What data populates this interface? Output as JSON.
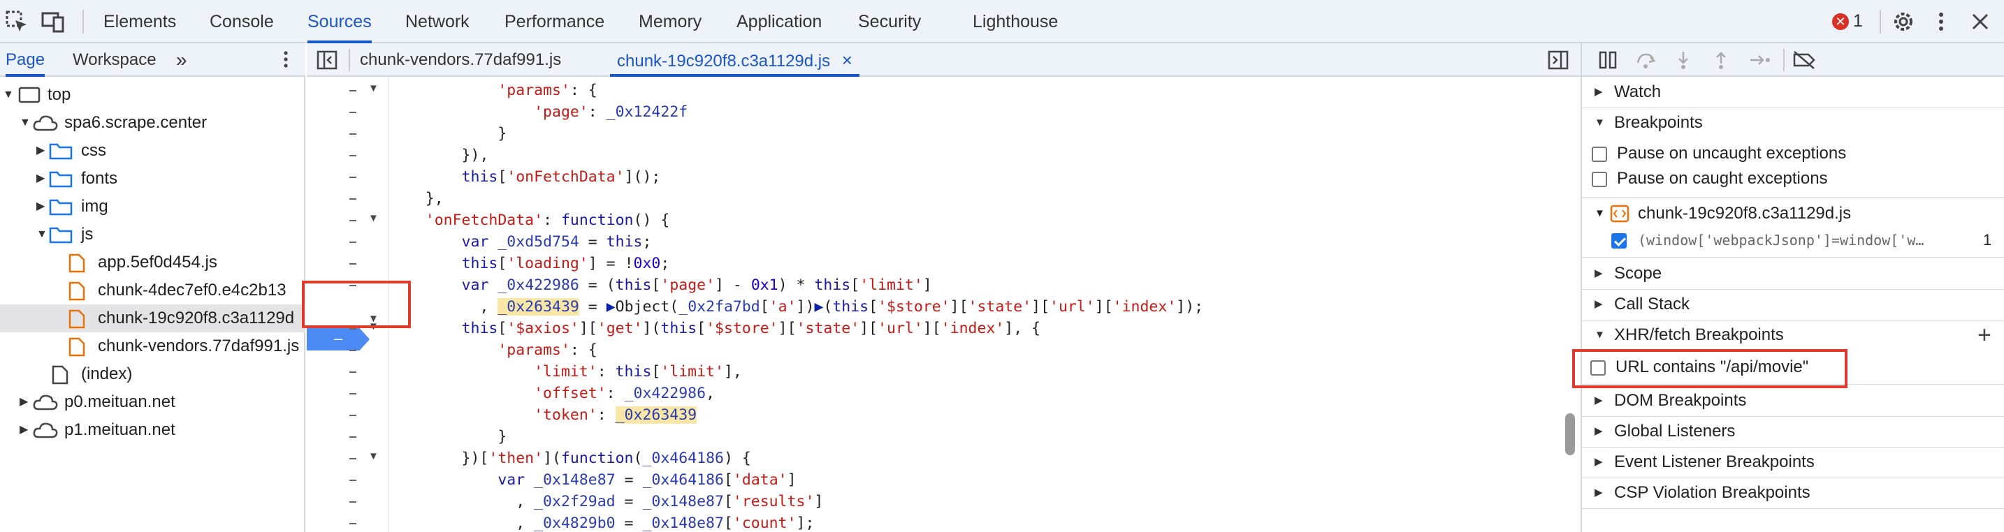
{
  "toolbar": {
    "tabs": [
      "Elements",
      "Console",
      "Sources",
      "Network",
      "Performance",
      "Memory",
      "Application",
      "Security",
      "Lighthouse"
    ],
    "active_tab": "Sources",
    "error_count": "1"
  },
  "navigator": {
    "tabs": [
      "Page",
      "Workspace"
    ],
    "more": "»",
    "tree": [
      {
        "label": "top"
      },
      {
        "label": "spa6.scrape.center"
      },
      {
        "label": "css"
      },
      {
        "label": "fonts"
      },
      {
        "label": "img"
      },
      {
        "label": "js"
      },
      {
        "label": "app.5ef0d454.js"
      },
      {
        "label": "chunk-4dec7ef0.e4c2b13"
      },
      {
        "label": "chunk-19c920f8.c3a1129d"
      },
      {
        "label": "chunk-vendors.77daf991.js"
      },
      {
        "label": "(index)"
      },
      {
        "label": "p0.meituan.net"
      },
      {
        "label": "p1.meituan.net"
      }
    ]
  },
  "editor": {
    "tabs": [
      "chunk-vendors.77daf991.js",
      "chunk-19c920f8.c3a1129d.js"
    ],
    "close_icon": "×",
    "breakpoint_marker": "–",
    "code": [
      "            'params': {",
      "                'page': _0x12422f",
      "            }",
      "        }),",
      "        this['onFetchData']();",
      "    },",
      "    'onFetchData': function() {",
      "        var _0xd5d754 = this;",
      "        this['loading'] = !0x0;",
      "        var _0x422986 = (this['page'] - 0x1) * this['limit']",
      "          , _0x263439 = ▶Object(_0x2fa7bd['a'])▶(this['$store']['state']['url']['index']);",
      "        this['$axios']['get'](this['$store']['state']['url']['index'], {",
      "            'params': {",
      "                'limit': this['limit'],",
      "                'offset': _0x422986,",
      "                'token': _0x263439",
      "            }",
      "        })['then'](function(_0x464186) {",
      "            var _0x148e87 = _0x464186['data']",
      "              , _0x2f29ad = _0x148e87['results']",
      "              , _0x4829b0 = _0x148e87['count'];"
    ]
  },
  "debugger": {
    "sections": {
      "watch": "Watch",
      "breakpoints": "Breakpoints",
      "pause_uncaught": "Pause on uncaught exceptions",
      "pause_caught": "Pause on caught exceptions",
      "bp_file": "chunk-19c920f8.c3a1129d.js",
      "bp_code": "(window['webpackJsonp']=window['w…",
      "bp_line": "1",
      "scope": "Scope",
      "call_stack": "Call Stack",
      "xhr": "XHR/fetch Breakpoints",
      "xhr_item": "URL contains \"/api/movie\"",
      "add": "+",
      "dom": "DOM Breakpoints",
      "global": "Global Listeners",
      "event": "Event Listener Breakpoints",
      "csp": "CSP Violation Breakpoints"
    }
  },
  "colors": {
    "accent": "#1a56c8",
    "highlight_box": "#e03c2d",
    "breakpoint": "#4c8bf5"
  }
}
